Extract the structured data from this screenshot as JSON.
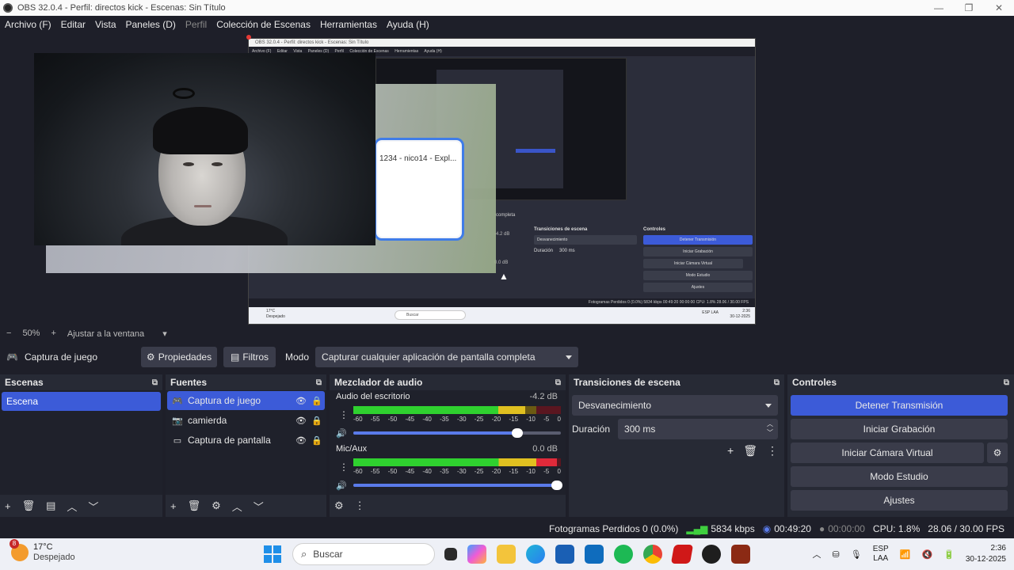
{
  "window": {
    "title": "OBS 32.0.4 - Perfil: directos kick - Escenas: Sin Título",
    "controls": [
      "—",
      "❐",
      "✕"
    ]
  },
  "menu": [
    {
      "label": "Archivo (F)",
      "enabled": true
    },
    {
      "label": "Editar",
      "enabled": true
    },
    {
      "label": "Vista",
      "enabled": true
    },
    {
      "label": "Paneles (D)",
      "enabled": true
    },
    {
      "label": "Perfil",
      "enabled": false
    },
    {
      "label": "Colección de Escenas",
      "enabled": true
    },
    {
      "label": "Herramientas",
      "enabled": true
    },
    {
      "label": "Ayuda (H)",
      "enabled": true
    }
  ],
  "preview": {
    "explorer_text": "1234 - nico14 - Expl...",
    "nested": {
      "title": "OBS 32.0.4 - Perfil: directos kick - Escenas: Sin Título",
      "menu": [
        "Archivo (F)",
        "Editar",
        "Vista",
        "Paneles (D)",
        "Perfil",
        "Colección de Escenas",
        "Herramientas",
        "Ayuda (H)"
      ],
      "mode_fragment": "completa",
      "transitions_header": "Transiciones de escena",
      "controls_header": "Controles",
      "transition": "Desvanecimiento",
      "duration_label": "Duración",
      "duration_value": "300 ms",
      "db1": "-4.2 dB",
      "db2": "0.0 dB",
      "buttons": [
        "Detener Transmisión",
        "Iniciar Grabación",
        "Iniciar Cámara Virtual",
        "Modo Estudio",
        "Ajustes"
      ],
      "status": "Fotogramas Perdidos 0 (0.0%)   5834 kbps   00:49:20   00:00:00   CPU: 1.8%   28.06 / 30.00 FPS",
      "weather_temp": "17°C",
      "weather_desc": "Despejado",
      "search": "Buscar",
      "lang": "ESP LAA",
      "time": "2:36",
      "date": "30-12-2025"
    }
  },
  "zoom": {
    "minus": "−",
    "level": "50%",
    "plus": "+",
    "fit": "Ajustar a la ventana"
  },
  "source_toolbar": {
    "source_name": "Captura de juego",
    "properties": "Propiedades",
    "filters": "Filtros",
    "mode_label": "Modo",
    "mode_value": "Capturar cualquier aplicación de pantalla completa"
  },
  "scenes": {
    "header": "Escenas",
    "items": [
      "Escena"
    ]
  },
  "sources": {
    "header": "Fuentes",
    "items": [
      {
        "label": "Captura de juego",
        "icon": "gamepad-icon",
        "selected": true
      },
      {
        "label": "camierda",
        "icon": "camera-icon",
        "selected": false
      },
      {
        "label": "Captura de pantalla",
        "icon": "monitor-icon",
        "selected": false
      }
    ]
  },
  "mixer": {
    "header": "Mezclador de audio",
    "scale": [
      "-60",
      "-55",
      "-50",
      "-45",
      "-40",
      "-35",
      "-30",
      "-25",
      "-20",
      "-15",
      "-10",
      "-5",
      "0"
    ],
    "channels": [
      {
        "name": "Audio del escritorio",
        "db": "-4.2 dB",
        "level": 0.83,
        "volume": 0.79
      },
      {
        "name": "Mic/Aux",
        "db": "0.0 dB",
        "level": 0.98,
        "volume": 0.98
      }
    ]
  },
  "transitions": {
    "header": "Transiciones de escena",
    "selected": "Desvanecimiento",
    "duration_label": "Duración",
    "duration_value": "300 ms"
  },
  "controls": {
    "header": "Controles",
    "stop_stream": "Detener Transmisión",
    "start_recording": "Iniciar Grabación",
    "start_virtual_cam": "Iniciar Cámara Virtual",
    "studio_mode": "Modo Estudio",
    "settings": "Ajustes"
  },
  "status": {
    "dropped": "Fotogramas Perdidos 0 (0.0%)",
    "bitrate": "5834 kbps",
    "stream_time": "00:49:20",
    "rec_time": "00:00:00",
    "cpu": "CPU: 1.8%",
    "fps": "28.06 / 30.00 FPS"
  },
  "taskbar": {
    "weather_badge": "8",
    "temp": "17°C",
    "desc": "Despejado",
    "search": "Buscar",
    "lang1": "ESP",
    "lang2": "LAA",
    "time": "2:36",
    "date": "30-12-2025"
  },
  "colors": {
    "accent": "#3c5bd8",
    "bg": "#1e1f29",
    "dock": "#272a35"
  }
}
